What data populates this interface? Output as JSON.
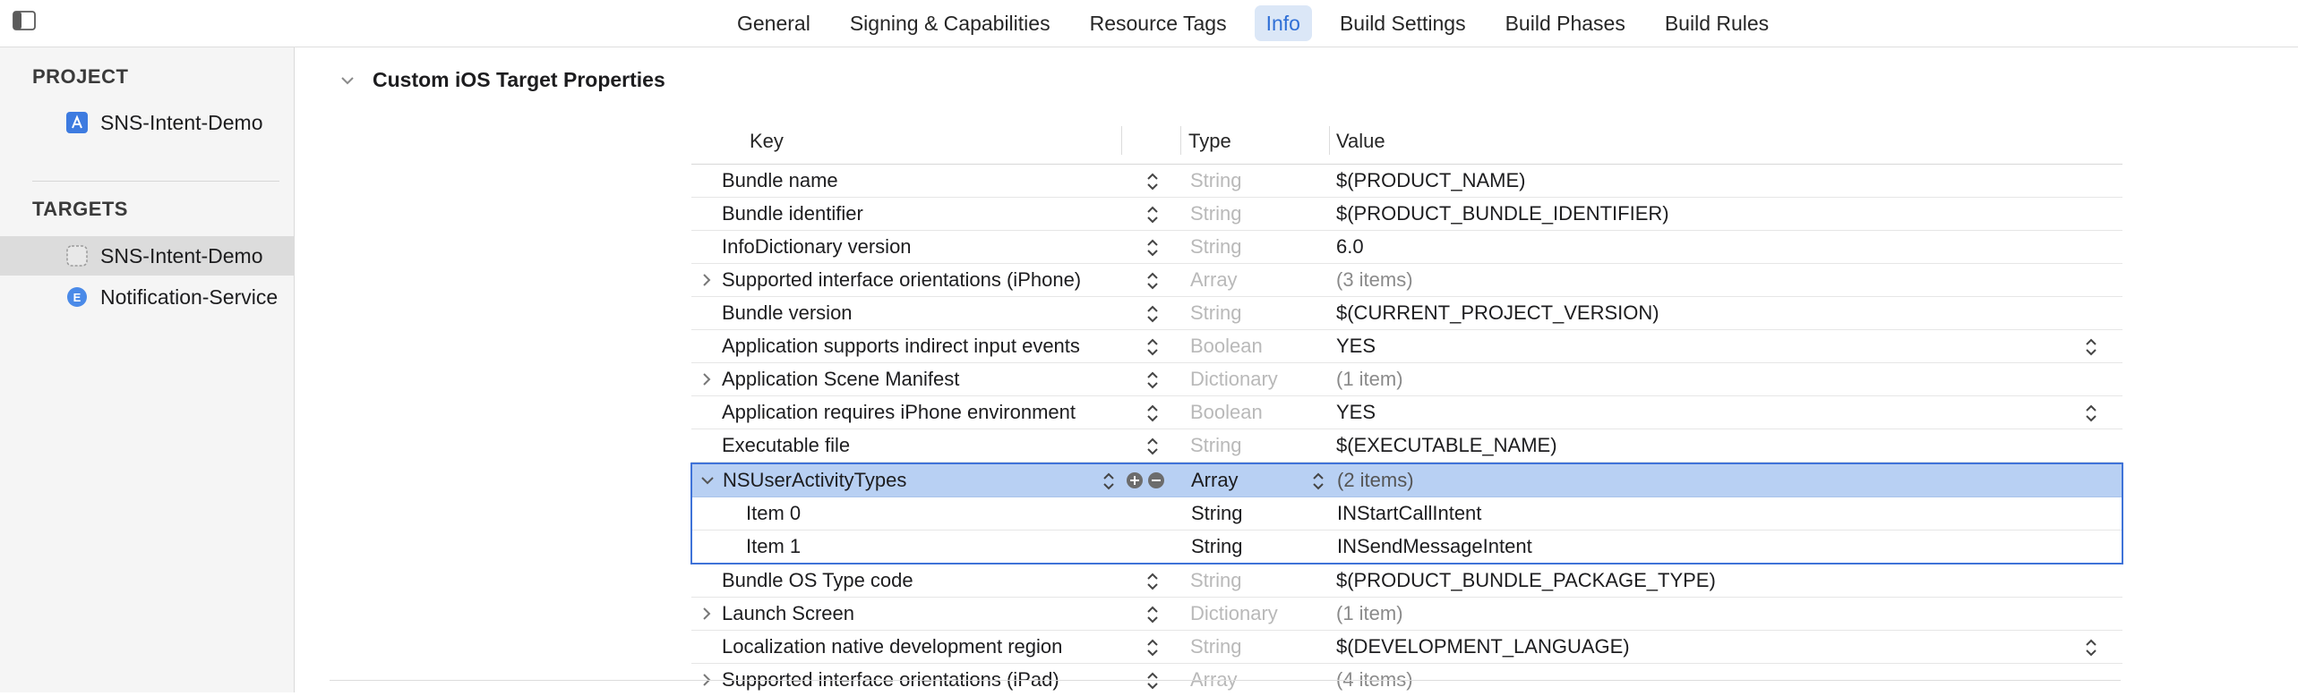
{
  "tabs": [
    {
      "label": "General",
      "active": false
    },
    {
      "label": "Signing & Capabilities",
      "active": false
    },
    {
      "label": "Resource Tags",
      "active": false
    },
    {
      "label": "Info",
      "active": true
    },
    {
      "label": "Build Settings",
      "active": false
    },
    {
      "label": "Build Phases",
      "active": false
    },
    {
      "label": "Build Rules",
      "active": false
    }
  ],
  "sidebar": {
    "project_header": "PROJECT",
    "project_item": "SNS-Intent-Demo",
    "targets_header": "TARGETS",
    "targets": [
      {
        "label": "SNS-Intent-Demo",
        "selected": true,
        "icon": "app-target-icon"
      },
      {
        "label": "Notification-Service",
        "selected": false,
        "icon": "extension-icon"
      }
    ]
  },
  "section": {
    "title": "Custom iOS Target Properties"
  },
  "plist": {
    "headers": {
      "key": "Key",
      "type": "Type",
      "value": "Value"
    },
    "rows": [
      {
        "key": "Bundle name",
        "type": "String",
        "value": "$(PRODUCT_NAME)"
      },
      {
        "key": "Bundle identifier",
        "type": "String",
        "value": "$(PRODUCT_BUNDLE_IDENTIFIER)"
      },
      {
        "key": "InfoDictionary version",
        "type": "String",
        "value": "6.0"
      },
      {
        "key": "Supported interface orientations (iPhone)",
        "type": "Array",
        "value": "(3 items)"
      },
      {
        "key": "Bundle version",
        "type": "String",
        "value": "$(CURRENT_PROJECT_VERSION)"
      },
      {
        "key": "Application supports indirect input events",
        "type": "Boolean",
        "value": "YES"
      },
      {
        "key": "Application Scene Manifest",
        "type": "Dictionary",
        "value": "(1 item)"
      },
      {
        "key": "Application requires iPhone environment",
        "type": "Boolean",
        "value": "YES"
      },
      {
        "key": "Executable file",
        "type": "String",
        "value": "$(EXECUTABLE_NAME)"
      }
    ],
    "selected_row": {
      "key": "NSUserActivityTypes",
      "type": "Array",
      "value": "(2 items)"
    },
    "children": [
      {
        "key": "Item 0",
        "type": "String",
        "value": "INStartCallIntent"
      },
      {
        "key": "Item 1",
        "type": "String",
        "value": "INSendMessageIntent"
      }
    ],
    "rows_after": [
      {
        "key": "Bundle OS Type code",
        "type": "String",
        "value": "$(PRODUCT_BUNDLE_PACKAGE_TYPE)"
      },
      {
        "key": "Launch Screen",
        "type": "Dictionary",
        "value": "(1 item)"
      },
      {
        "key": "Localization native development region",
        "type": "String",
        "value": "$(DEVELOPMENT_LANGUAGE)"
      },
      {
        "key": "Supported interface orientations (iPad)",
        "type": "Array",
        "value": "(4 items)"
      }
    ]
  },
  "colors": {
    "accent": "#2f6fd6",
    "selection": "#b8d0f3",
    "selection_border": "#3f73d8"
  }
}
